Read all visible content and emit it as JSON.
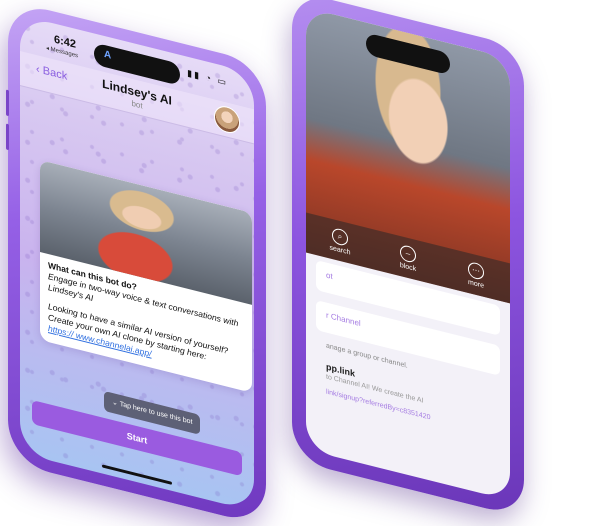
{
  "front": {
    "status": {
      "time": "6:42",
      "back_crumb": "◂ Messages",
      "island_letter": "A",
      "signal_icons": "▮▮ ◔ ▭"
    },
    "nav": {
      "back_label": "Back",
      "title": "Lindsey's AI",
      "subtitle": "bot"
    },
    "message": {
      "heading": "What can this bot do?",
      "line1": "Engage in two-way voice & text conversations with Lindsey's AI",
      "line2": "Looking to have a similar AI version of yourself? Create your own AI clone by starting here:",
      "link": "https:// www.channelai.app/"
    },
    "tap_hint": "Tap here to use this bot",
    "start_label": "Start"
  },
  "back": {
    "actions": [
      {
        "icon": "search-icon",
        "label": "search"
      },
      {
        "icon": "block-icon",
        "label": "block"
      },
      {
        "icon": "more-icon",
        "label": "more"
      }
    ],
    "rows": [
      {
        "label": "ot"
      },
      {
        "label": "r Channel"
      }
    ],
    "hint": "anage a group or channel.",
    "link_title": "pp.link",
    "link_sub": "to Channel AI! We create the AI",
    "link_url": "link/signup?referredBy=c8351420"
  }
}
